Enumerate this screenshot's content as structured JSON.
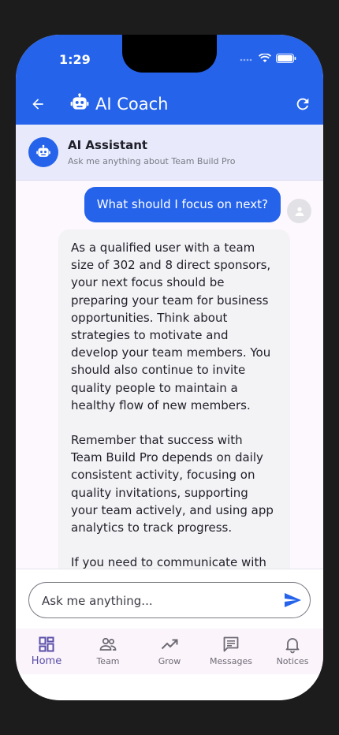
{
  "status_bar": {
    "time": "1:29"
  },
  "header": {
    "title": "AI Coach",
    "back_icon": "arrow-left-icon",
    "title_icon": "robot-icon",
    "refresh_icon": "refresh-icon",
    "background": "#2563eb"
  },
  "assistant": {
    "name": "AI Assistant",
    "subtitle": "Ask me anything about Team Build Pro"
  },
  "chat": {
    "user_message": "What should I focus on next?",
    "ai_paragraphs": [
      "As a qualified user with a team size of 302 and 8 direct sponsors, your next focus should be preparing your team for business opportunities. Think about strategies to motivate and develop your team members. You should also continue to invite quality people to maintain a healthy flow of new members.",
      "Remember that success with Team Build Pro depends on daily consistent activity, focusing on quality invitations, supporting your team actively, and using app analytics to track progress.",
      "If you need to communicate with"
    ]
  },
  "composer": {
    "placeholder": "Ask me anything...",
    "send_icon": "send-icon"
  },
  "nav": {
    "items": [
      {
        "label": "Home",
        "icon": "home-grid-icon",
        "active": true
      },
      {
        "label": "Team",
        "icon": "people-icon",
        "active": false
      },
      {
        "label": "Grow",
        "icon": "trending-up-icon",
        "active": false
      },
      {
        "label": "Messages",
        "icon": "message-icon",
        "active": false
      },
      {
        "label": "Notices",
        "icon": "bell-icon",
        "active": false
      }
    ]
  },
  "colors": {
    "primary": "#2563eb",
    "nav_active": "#5a4fa8",
    "banner": "#e8eafb"
  }
}
